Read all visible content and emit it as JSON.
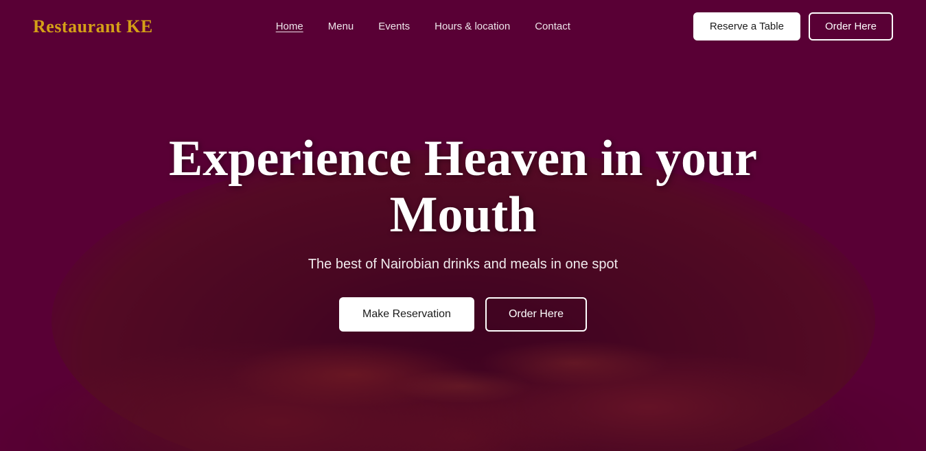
{
  "brand": {
    "name": "Restaurant KE",
    "color": "#d4a017"
  },
  "nav": {
    "links": [
      {
        "label": "Home",
        "active": true,
        "href": "#"
      },
      {
        "label": "Menu",
        "active": false,
        "href": "#"
      },
      {
        "label": "Events",
        "active": false,
        "href": "#"
      },
      {
        "label": "Hours & location",
        "active": false,
        "href": "#"
      },
      {
        "label": "Contact",
        "active": false,
        "href": "#"
      }
    ],
    "reserve_button": "Reserve a Table",
    "order_button": "Order Here"
  },
  "hero": {
    "title": "Experience Heaven in your Mouth",
    "subtitle": "The best of Nairobian drinks and meals in one spot",
    "make_reservation_label": "Make Reservation",
    "order_here_label": "Order Here"
  }
}
